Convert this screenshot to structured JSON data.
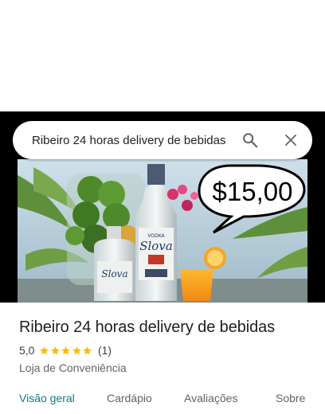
{
  "search": {
    "query": "Ribeiro 24 horas delivery de bebidas"
  },
  "photo": {
    "price_bubble": "$15,00",
    "bottle_label_brand": "Slova",
    "bottle_label_type": "VODKA"
  },
  "place": {
    "name": "Ribeiro 24 horas delivery de bebidas",
    "rating": "5,0",
    "stars": 5,
    "review_count": "(1)",
    "category": "Loja de Conveniência"
  },
  "tabs": [
    {
      "label": "Visão geral",
      "active": true
    },
    {
      "label": "Cardápio",
      "active": false
    },
    {
      "label": "Avaliações",
      "active": false
    },
    {
      "label": "Sobre",
      "active": false
    }
  ],
  "colors": {
    "star": "#fbbc04",
    "active_tab": "#0b7a8a",
    "price_text": "#000000"
  }
}
